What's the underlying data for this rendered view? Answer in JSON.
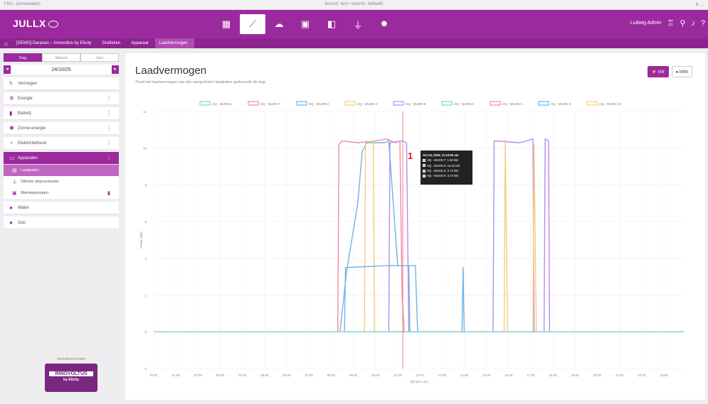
{
  "browser": {
    "left": "Finn...(unreadable)",
    "center": "branch: test • commit: 3af8ad0",
    "right": "⇅ ..."
  },
  "app": {
    "logo": "JULLX",
    "user": "Ludwig Admin"
  },
  "breadcrumb": {
    "items": [
      "[DEMO] Daranan – Innovoltus by Elicity",
      "Grafieken",
      "Apparaat",
      "Laadvermogen"
    ]
  },
  "sidebar": {
    "tabs": [
      "Dag",
      "Maand",
      "Jaar"
    ],
    "date": "24/10/25",
    "items": [
      {
        "label": "Vermogen",
        "icon": "power-icon",
        "dots": false
      },
      {
        "label": "Energie",
        "icon": "gear-icon",
        "dots": true
      },
      {
        "label": "Batterij",
        "icon": "battery-icon",
        "dots": true
      },
      {
        "label": "Zonne-energie",
        "icon": "sun-icon",
        "dots": true
      },
      {
        "label": "Elektriciteitsnet",
        "icon": "pylon-icon",
        "dots": true
      }
    ],
    "group": {
      "label": "Apparaten",
      "subitems": [
        "Laadpalen",
        "Slimme stopcontacten",
        "Warmtepompen"
      ]
    },
    "extra": [
      "Water",
      "Gas"
    ],
    "sponsor_label": "Gerealiseerd door",
    "sponsor_name": "INNOVOLTUS",
    "sponsor_sub": "by Elicity"
  },
  "panel": {
    "title": "Laadvermogen",
    "subtitle": "Toont het laadvermogen van alle aangesloten laadpalen gedurende de dag.",
    "unit_buttons": [
      "kW",
      "kWh"
    ]
  },
  "tooltip": {
    "title": "Oct 24, 2025, 11:14:00 am",
    "lines": [
      {
        "label": "HQ - MUON 7: 1.58 kW",
        "color": "#f08aa0"
      },
      {
        "label": "HQ - MUON 8: 10.32 kW",
        "color": "#b48cf0"
      },
      {
        "label": "HQ - MUON 3: 3.72 kW",
        "color": "#6fb3e8"
      },
      {
        "label": "HQ - MUON 9: 3.73 kW",
        "color": "#6fb3e8"
      }
    ]
  },
  "marker_label": "1",
  "chart_data": {
    "type": "line",
    "title": "",
    "xlabel": "Tijd (per uur)",
    "ylabel": "Power (kW)",
    "ylim": [
      -2,
      12
    ],
    "yticks": [
      "12",
      "10",
      "8",
      "6",
      "4",
      "2",
      "0",
      "-2"
    ],
    "xticks": [
      "00:00",
      "01:00",
      "02:00",
      "03:00",
      "04:00",
      "05:00",
      "06:00",
      "07:00",
      "08:00",
      "09:00",
      "10:00",
      "11:00",
      "12:00",
      "13:00",
      "14:00",
      "15:00",
      "16:00",
      "17:00",
      "18:00",
      "19:00",
      "20:00",
      "21:00",
      "22:00",
      "23:00"
    ],
    "legend": [
      "HQ - MUON 1",
      "HQ - MUON 7",
      "HQ - MUON 2",
      "HQ - MUON 4",
      "HQ - MUON 8",
      "HQ - MUON 3",
      "HQ - MUON 5",
      "HQ - MUON 9",
      "HQ - MUON 10"
    ],
    "legend_colors": [
      "#7fd1c8",
      "#f08aa0",
      "#6fb3e8",
      "#f6cd7a",
      "#b48cf0",
      "#7fd1c8",
      "#f08aa0",
      "#6fb3e8",
      "#f6cd7a"
    ],
    "series": [
      {
        "name": "HQ - MUON 7",
        "color": "#f08aa0",
        "points": [
          [
            8.3,
            0
          ],
          [
            8.35,
            10.2
          ],
          [
            8.5,
            10.4
          ],
          [
            9.2,
            10.3
          ],
          [
            10,
            10.4
          ],
          [
            10.5,
            10.5
          ],
          [
            10.9,
            10.3
          ],
          [
            11.1,
            10.4
          ],
          [
            11.2,
            2
          ],
          [
            11.3,
            0
          ]
        ]
      },
      {
        "name": "HQ - MUON 8",
        "color": "#b48cf0",
        "points": [
          [
            10.6,
            0
          ],
          [
            10.65,
            10.3
          ],
          [
            11.2,
            10.4
          ],
          [
            11.4,
            10.3
          ],
          [
            11.5,
            0
          ],
          [
            15.3,
            0
          ],
          [
            15.35,
            10.4
          ],
          [
            16.5,
            10.3
          ],
          [
            17.1,
            10.5
          ],
          [
            17.15,
            0
          ],
          [
            17.6,
            0
          ],
          [
            17.65,
            10.5
          ],
          [
            17.8,
            10.4
          ],
          [
            17.85,
            0
          ]
        ]
      },
      {
        "name": "HQ - MUON 3",
        "color": "#6fb3e8",
        "points": [
          [
            8.4,
            0
          ],
          [
            8.7,
            3.3
          ],
          [
            9.2,
            7
          ],
          [
            9.4,
            9.8
          ],
          [
            9.6,
            10.3
          ],
          [
            10.4,
            10.3
          ],
          [
            10.6,
            10.4
          ],
          [
            11,
            3.6
          ],
          [
            11.8,
            3.6
          ],
          [
            11.9,
            0
          ],
          [
            13.9,
            0
          ],
          [
            13.95,
            3.5
          ],
          [
            14,
            0
          ]
        ]
      },
      {
        "name": "HQ - MUON 4",
        "color": "#f6cd7a",
        "points": [
          [
            9.5,
            0
          ],
          [
            9.55,
            10.4
          ],
          [
            9.9,
            10.3
          ],
          [
            9.95,
            0
          ],
          [
            15.8,
            0
          ],
          [
            15.85,
            10.5
          ],
          [
            15.95,
            0
          ],
          [
            17.1,
            0
          ],
          [
            17.15,
            10.2
          ],
          [
            17.25,
            0
          ]
        ]
      },
      {
        "name": "HQ - MUON 9",
        "color": "#6fb3e8",
        "points": [
          [
            8.6,
            0
          ],
          [
            8.65,
            3.5
          ],
          [
            10.5,
            3.6
          ],
          [
            11.5,
            3.6
          ],
          [
            11.55,
            0
          ]
        ]
      },
      {
        "name": "HQ - MUON 1",
        "color": "#7fd1c8",
        "points": [
          [
            0,
            0
          ],
          [
            23.9,
            0
          ]
        ]
      }
    ]
  }
}
